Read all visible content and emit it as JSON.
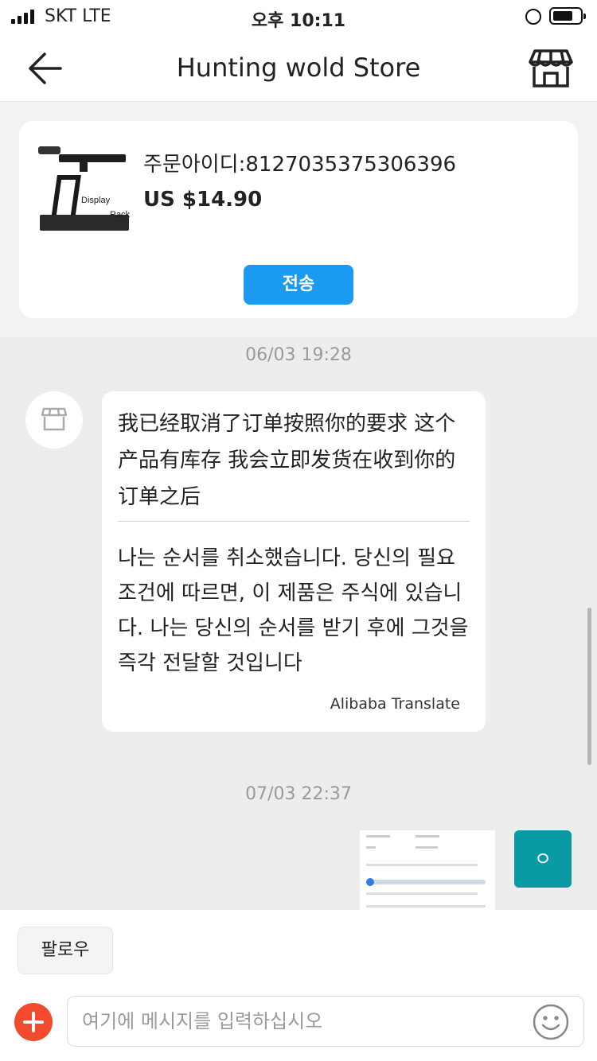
{
  "status_bar": {
    "carrier": "SKT   LTE",
    "time": "오후 10:11"
  },
  "header": {
    "title": "Hunting wold Store",
    "back_icon": "arrow-left-icon",
    "store_icon": "storefront-icon"
  },
  "order": {
    "order_id": "주문아이디:8127035375306396",
    "price": "US $14.90",
    "send_label": "전송",
    "thumb_text_1": "Display",
    "thumb_text_2": "Rack",
    "send_color": "#1a9af0"
  },
  "messages": [
    {
      "timestamp": "06/03 19:28",
      "original": "我已经取消了订单按照你的要求 这个产品有库存 我会立即发货在收到你的订单之后",
      "translation": "나는 순서를 취소했습니다. 당신의 필요 조건에 따르면, 이 제품은 주식에 있습니다. 나는 당신의 순서를 받기 후에 그것을 즉각 전달할 것입니다",
      "credit": "Alibaba Translate"
    },
    {
      "timestamp": "07/03 22:37",
      "my_avatar_text": "ㅇ",
      "my_avatar_color": "#0a9aa3"
    }
  ],
  "footer": {
    "follow_label": "팔로우",
    "input_placeholder": "여기에 메시지를 입력하십시오",
    "plus_color": "#f24a2d",
    "emoji_icon": "smiley-icon"
  }
}
